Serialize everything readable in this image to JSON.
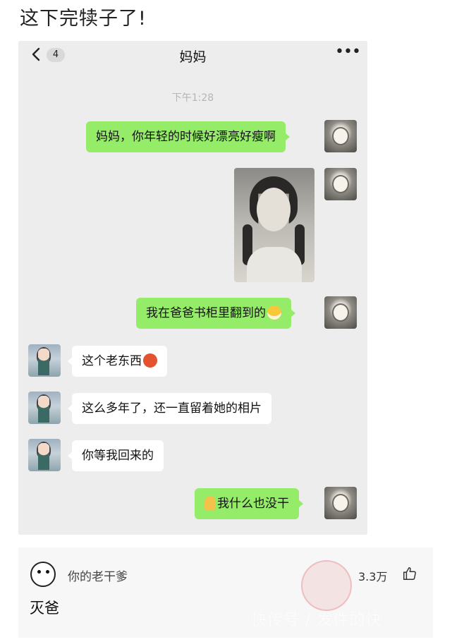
{
  "post": {
    "title": "这下完犊子了!"
  },
  "chat": {
    "back_badge": "4",
    "contact_name": "妈妈",
    "more_label": "•••",
    "timestamp": "下午1:28",
    "messages": [
      {
        "from": "me",
        "type": "text",
        "text": "妈妈，你年轻的时候好漂亮好瘦啊"
      },
      {
        "from": "me",
        "type": "image"
      },
      {
        "from": "me",
        "type": "text",
        "text": "我在爸爸书柜里翻到的",
        "emoji": "grin-emoji"
      },
      {
        "from": "mom",
        "type": "text",
        "text": "这个老东西",
        "emoji": "angry-emoji"
      },
      {
        "from": "mom",
        "type": "text",
        "text": "这么多年了，还一直留着她的相片"
      },
      {
        "from": "mom",
        "type": "text",
        "text": "你等我回来的"
      },
      {
        "from": "me",
        "type": "text",
        "text": "我什么也没干",
        "emoji": "pray-emoji"
      }
    ]
  },
  "comment": {
    "username": "你的老干爹",
    "likes": "3.3万",
    "text": "灭爸",
    "watermark": "快传号 / 发件的快"
  },
  "colors": {
    "outgoing_bubble": "#95ec69",
    "incoming_bubble": "#ffffff",
    "chat_background": "#ededed"
  }
}
